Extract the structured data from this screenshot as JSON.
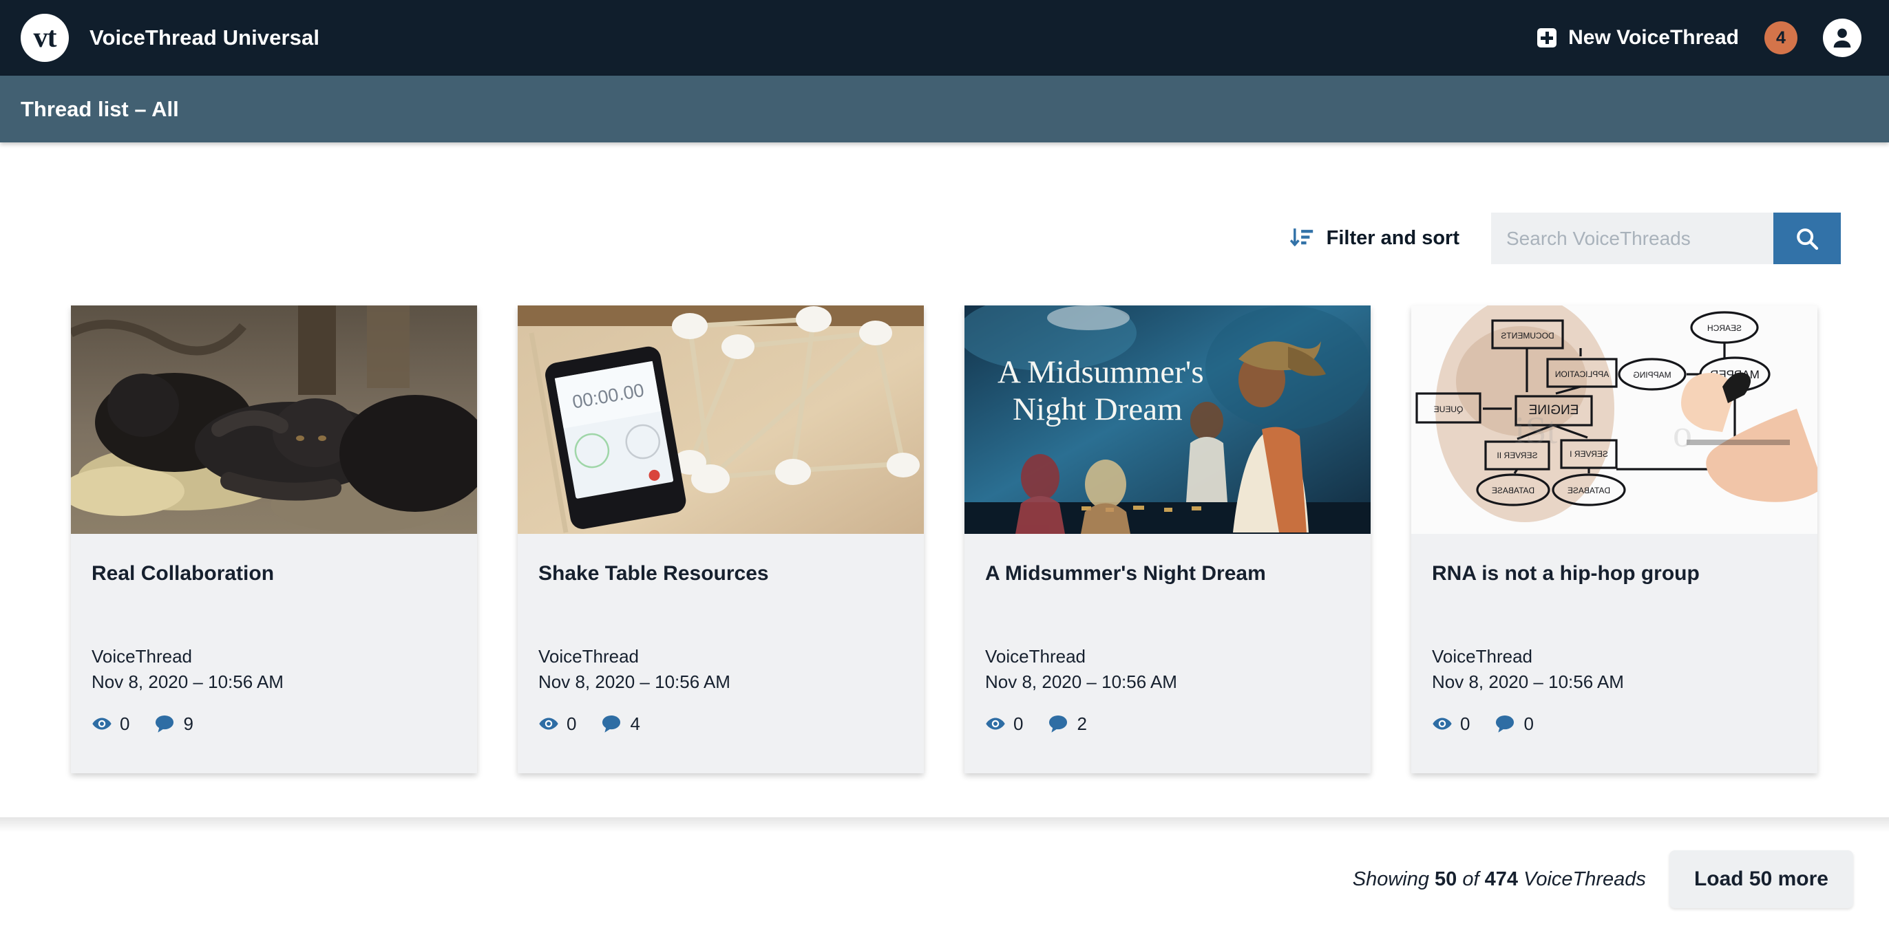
{
  "header": {
    "logo_text": "vt",
    "logo_icon": "voicethread-logo-icon",
    "brand_title": "VoiceThread Universal",
    "new_thread_label": "New VoiceThread",
    "new_thread_icon": "plus-square-icon",
    "notification_count": "4",
    "account_icon": "user-avatar-icon"
  },
  "subheader": {
    "title": "Thread list – All"
  },
  "toolbar": {
    "filter_sort_label": "Filter and sort",
    "filter_sort_icon": "sort-descending-icon",
    "search_placeholder": "Search VoiceThreads",
    "search_value": "",
    "search_button_icon": "search-icon"
  },
  "cards": [
    {
      "title": "Real Collaboration",
      "owner": "VoiceThread",
      "date": "Nov 8, 2020 – 10:56 AM",
      "views": "0",
      "comments": "9",
      "views_icon": "eye-icon",
      "comments_icon": "comment-bubble-icon",
      "thumb_alt": "three chimpanzees resting on straw"
    },
    {
      "title": "Shake Table Resources",
      "owner": "VoiceThread",
      "date": "Nov 8, 2020 – 10:56 AM",
      "views": "0",
      "comments": "4",
      "views_icon": "eye-icon",
      "comments_icon": "comment-bubble-icon",
      "thumb_alt": "smartphone stopwatch beside marshmallow and toothpick tower"
    },
    {
      "title": "A Midsummer's Night Dream",
      "owner": "VoiceThread",
      "date": "Nov 8, 2020 – 10:56 AM",
      "views": "0",
      "comments": "2",
      "views_icon": "eye-icon",
      "comments_icon": "comment-bubble-icon",
      "thumb_alt": "stage play titled A Midsummer's Night Dream"
    },
    {
      "title": "RNA is not a hip-hop group",
      "owner": "VoiceThread",
      "date": "Nov 8, 2020 – 10:56 AM",
      "views": "0",
      "comments": "0",
      "views_icon": "eye-icon",
      "comments_icon": "comment-bubble-icon",
      "thumb_alt": "person drawing a flowchart on a glass board"
    }
  ],
  "footer": {
    "showing_prefix": "Showing ",
    "showing_count": "50",
    "showing_middle": " of ",
    "showing_total": "474",
    "showing_suffix": " VoiceThreads",
    "load_more_label": "Load 50 more"
  },
  "colors": {
    "topbar_bg": "#101e2c",
    "subheader_bg": "#426072",
    "accent_blue": "#3272a8",
    "badge_orange": "#d4744a",
    "card_bg": "#f0f1f3",
    "text_dark": "#16202e"
  }
}
